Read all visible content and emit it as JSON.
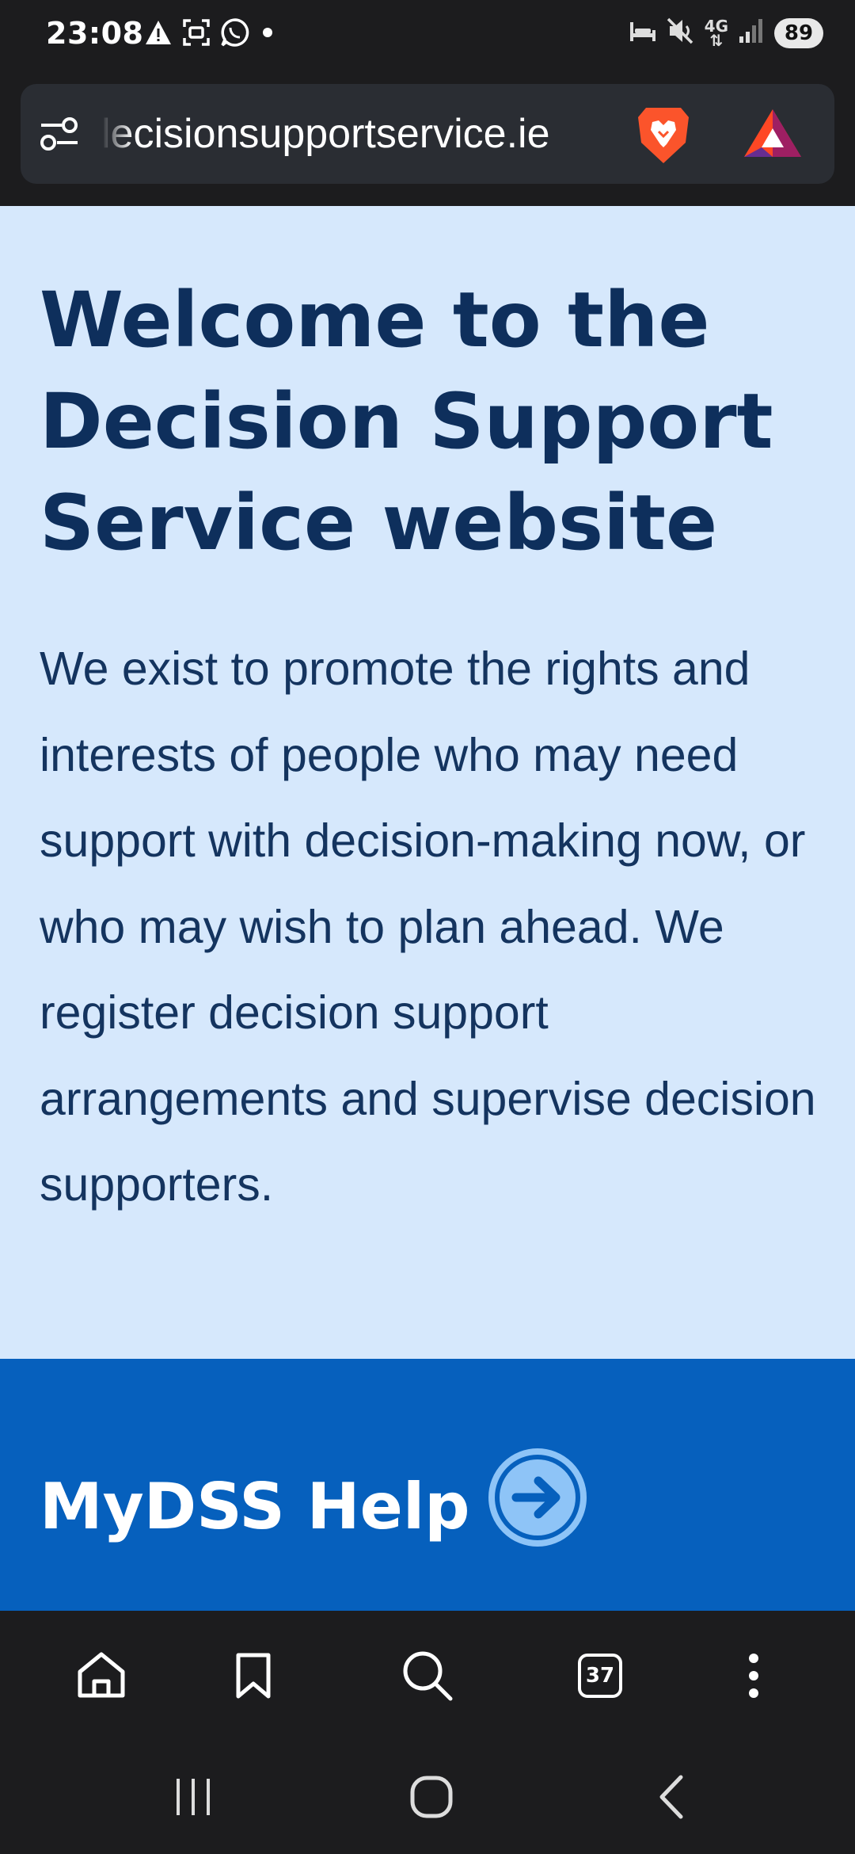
{
  "status_bar": {
    "time": "23:08",
    "network_label": "4G",
    "battery": "89",
    "left_icons": [
      "warning-icon",
      "screenshot-icon",
      "whatsapp-icon",
      "dot-icon"
    ],
    "right_icons": [
      "sleep-icon",
      "mute-icon",
      "signal-icon"
    ]
  },
  "address_bar": {
    "url_visible": "lecisionsupportservice.ie",
    "icons": [
      "site-settings-icon",
      "brave-shields-icon",
      "brave-rewards-icon"
    ]
  },
  "hero": {
    "title": "Welcome to the Decision Support Service website",
    "body": "We exist to promote the rights and interests of people who may need support with decision-making now, or who may wish to plan ahead. We register decision support arrangements and supervise decision supporters."
  },
  "help_banner": {
    "label": "MyDSS Help",
    "icon": "arrow-right-circle-icon"
  },
  "bottom_nav": {
    "tab_count": "37",
    "icons": [
      "home-icon",
      "bookmark-icon",
      "search-icon",
      "tabs-icon",
      "more-icon"
    ]
  },
  "system_nav": {
    "icons": [
      "recents-icon",
      "home-circle-icon",
      "back-icon"
    ]
  },
  "colors": {
    "hero_background": "#d6e8fc",
    "title_color": "#0e2f5c",
    "banner_background": "#0660bd",
    "chrome_background": "#1c1c1e"
  }
}
